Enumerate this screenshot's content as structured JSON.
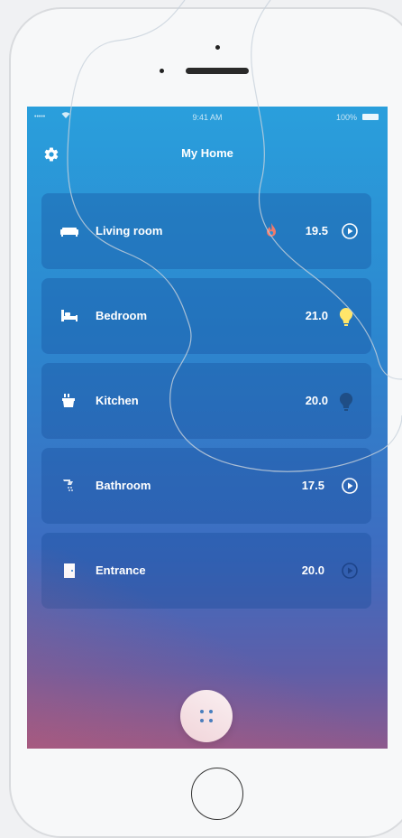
{
  "status_bar": {
    "signal": "•••••",
    "time": "9:41 AM",
    "battery": "100%"
  },
  "header": {
    "title": "My Home"
  },
  "rooms": [
    {
      "name": "Living room",
      "temperature": "19.5",
      "status": "heating"
    },
    {
      "name": "Bedroom",
      "temperature": "21.0",
      "status": "light-on"
    },
    {
      "name": "Kitchen",
      "temperature": "20.0",
      "status": "light-off"
    },
    {
      "name": "Bathroom",
      "temperature": "17.5",
      "status": "play"
    },
    {
      "name": "Entrance",
      "temperature": "20.0",
      "status": "play-dim"
    }
  ],
  "colors": {
    "heat": "#f07a6a",
    "light_on": "#ffe66a",
    "light_off": "#1f4e86",
    "fab_dots": "#2f86cf"
  }
}
